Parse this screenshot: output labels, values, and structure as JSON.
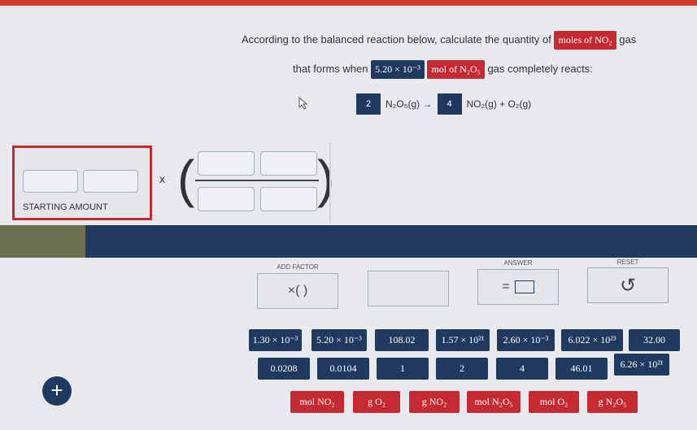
{
  "question": {
    "line1_prefix": "According to the balanced reaction below, calculate the quantity of",
    "line1_chip": "moles of NO₂",
    "line1_suffix": "gas",
    "line2_prefix": "that forms when",
    "line2_chip_value": "5.20 × 10⁻³",
    "line2_chip_unit": "mol of N₂O₅",
    "line2_suffix": "gas completely reacts:"
  },
  "equation": {
    "coef1": "2",
    "reactant": "N₂O₅(g) →",
    "coef2": "4",
    "products": "NO₂(g) + O₂(g)"
  },
  "workspace": {
    "starting_label": "STARTING AMOUNT",
    "times_symbol": "x"
  },
  "controls": {
    "add_factor_label": "ADD FACTOR",
    "add_factor_text": "×(   )",
    "answer_label": "ANSWER",
    "answer_text": "=",
    "reset_label": "RESET",
    "reset_icon": "↺"
  },
  "tiles_row1": [
    "1.30 × 10⁻³",
    "5.20 × 10⁻³",
    "108.02",
    "1.57 × 10²¹",
    "2.60 × 10⁻³",
    "6.022 × 10²³",
    "32.00"
  ],
  "tiles_row2": [
    "0.0208",
    "0.0104",
    "1",
    "2",
    "4",
    "46.01",
    "6.26 × 10²¹"
  ],
  "tiles_row3": [
    "mol NO₂",
    "g O₂",
    "g NO₂",
    "mol N₂O₅",
    "mol O₂",
    "g N₂O₅"
  ],
  "plus_button": "+",
  "colors": {
    "accent_red": "#c52a33",
    "navy": "#1f3a5e",
    "top_bar": "#d23b30"
  }
}
